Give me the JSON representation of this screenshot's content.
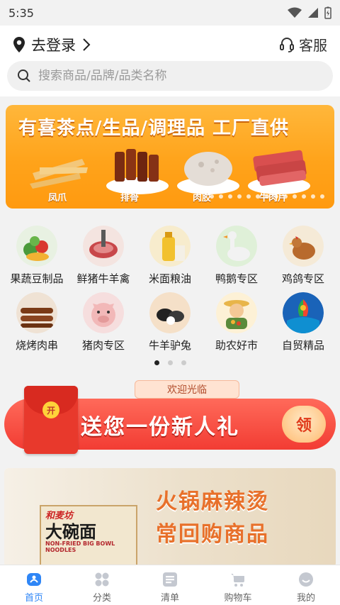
{
  "status": {
    "time": "5:35"
  },
  "header": {
    "location_label": "去登录",
    "service_label": "客服",
    "search_placeholder": "搜索商品/品牌/品类名称"
  },
  "banner": {
    "title": "有喜茶点/生品/调理品 工厂直供",
    "items": [
      "凤爪",
      "排骨",
      "肉胶",
      "牛肉片"
    ]
  },
  "categories": [
    {
      "label": "果蔬豆制品",
      "icon": "vegetables-icon"
    },
    {
      "label": "鲜猪牛羊禽",
      "icon": "meat-icon"
    },
    {
      "label": "米面粮油",
      "icon": "oil-grain-icon"
    },
    {
      "label": "鸭鹅专区",
      "icon": "goose-icon"
    },
    {
      "label": "鸡鸽专区",
      "icon": "chicken-icon"
    },
    {
      "label": "烧烤肉串",
      "icon": "bbq-icon"
    },
    {
      "label": "猪肉专区",
      "icon": "pig-icon"
    },
    {
      "label": "牛羊驴兔",
      "icon": "cattle-icon"
    },
    {
      "label": "助农好市",
      "icon": "farmer-icon"
    },
    {
      "label": "自贸精品",
      "icon": "free-trade-icon"
    }
  ],
  "promo": {
    "welcome": "欢迎光临",
    "text": "送您一份新人礼",
    "button": "领",
    "seal": "开"
  },
  "product": {
    "title_line1": "火锅麻辣烫",
    "title_line2": "常回购商品",
    "brand": "和麦坊",
    "name": "大碗面",
    "subtitle": "NON-FRIED BIG BOWL NOODLES"
  },
  "nav": [
    {
      "label": "首页",
      "icon": "home-icon",
      "active": true
    },
    {
      "label": "分类",
      "icon": "category-icon",
      "active": false
    },
    {
      "label": "清单",
      "icon": "list-icon",
      "active": false
    },
    {
      "label": "购物车",
      "icon": "cart-icon",
      "active": false
    },
    {
      "label": "我的",
      "icon": "profile-icon",
      "active": false
    }
  ],
  "colors": {
    "accent": "#2f86f6",
    "banner_orange": "#ffa31a",
    "promo_red": "#f23c33"
  }
}
